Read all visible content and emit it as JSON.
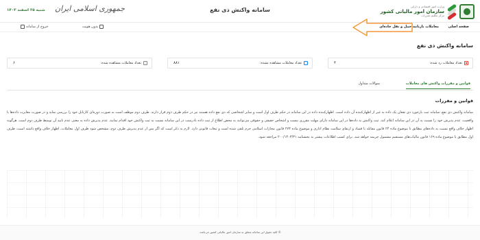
{
  "header": {
    "org_line1": "وزارت امور اقتصادی و دارایی",
    "org_line2": "سازمان امور مالیاتی کشور",
    "org_line3": "مرکز تنظیم مقررات",
    "app_title": "سامانه واکنش ذی نفع",
    "calligraphy": "جمهوری اسلامی ایران",
    "date": "شنبه ۲۵ اسفند ۱۴۰۳"
  },
  "nav": {
    "home": "صفحه اصلی",
    "transactions": "معاملات بارنامه حمل و نقل جاده‌ای",
    "user": "بدون هویت",
    "logout": "خروج از سامانه"
  },
  "page": {
    "title": "سامانه واکنش ذی نفع"
  },
  "stats": [
    {
      "label": "تعداد معاملات رد شده:",
      "value": "۴",
      "icon": "reject-icon",
      "color": "#e53935"
    },
    {
      "label": "تعداد معاملات مشاهده نشده:",
      "value": "۸۸۱",
      "icon": "unseen-icon",
      "color": "#1e88e5"
    },
    {
      "label": "تعداد معاملات مشاهده شده:",
      "value": "۶",
      "icon": "seen-icon",
      "color": "#8a8a8a"
    }
  ],
  "tabs": {
    "rules": "قوانین و مقررات واکنش های معاملات",
    "faq": "سوالات متداول"
  },
  "content": {
    "section_title": "قوانین و مقررات",
    "paragraph": "سامانه واکنش ذی نفع، سامانه ثبت بازخورد ذی نفعان یک داده به غیر از اظهارکننده آن داده است. اظهارکننده داده در این سامانه در حکم طرف اول است و سایر اشخاصی که ذی نفع داده هستند نیز در حکم طرف دوم قرار دارند. طرف دوم موظف است به صورت دوره‌ای کارتابل خود را بررسی نماید و در صورت مغایرت داده‌ها با واقعیت، عدم پذیرش خود را نسبت به آن در این سامانه اعلام کند. ثبت واکنش به داده‌ها در این سامانه دارای مهلت مقرری نیست و اشخاص حقیقی و حقوقی می‌توانند به محض اطلاع از ثبت داده نادرست در این سامانه نسبت به ثبت واکنش خود اقدام نمایند. عدم پذیرش داده به معنی عدم تایید آن توسط طرف دوم است. هرگونه اظهار خلاف واقع نسبت به داده‌های مطابق با موضوع ماده ۲۴ قانون مقابله با فساد و ارتقای سلامت نظام اداری و موضوع ماده ۲۷۴ قانون مجازات اسلامی جرم تلقی شده است و تبعات قانونی دارد. لازم به ذکر است که اگر پس از عدم پذیرش طرف دوم، مشخص شود طرف اول معاملات، اظهار خلاف واقع داشته است، طرف اول مطابق با موضوع ماده ۱۶۹ قانون مالیات‌های مستقیم مشمول جریمه خواهد شد. برای کسب اطلاعات بیشتر به بخشنامه ۲۰۰/۱۴۰۳/۳۱ مراجعه شود."
  },
  "footer": {
    "copyright": "© کلیه حقوق این سامانه متعلق به سازمان امور مالیاتی کشور می‌باشد."
  },
  "colors": {
    "brand_green": "#2e7d32",
    "annotation_arrow": "#f39c3a"
  }
}
